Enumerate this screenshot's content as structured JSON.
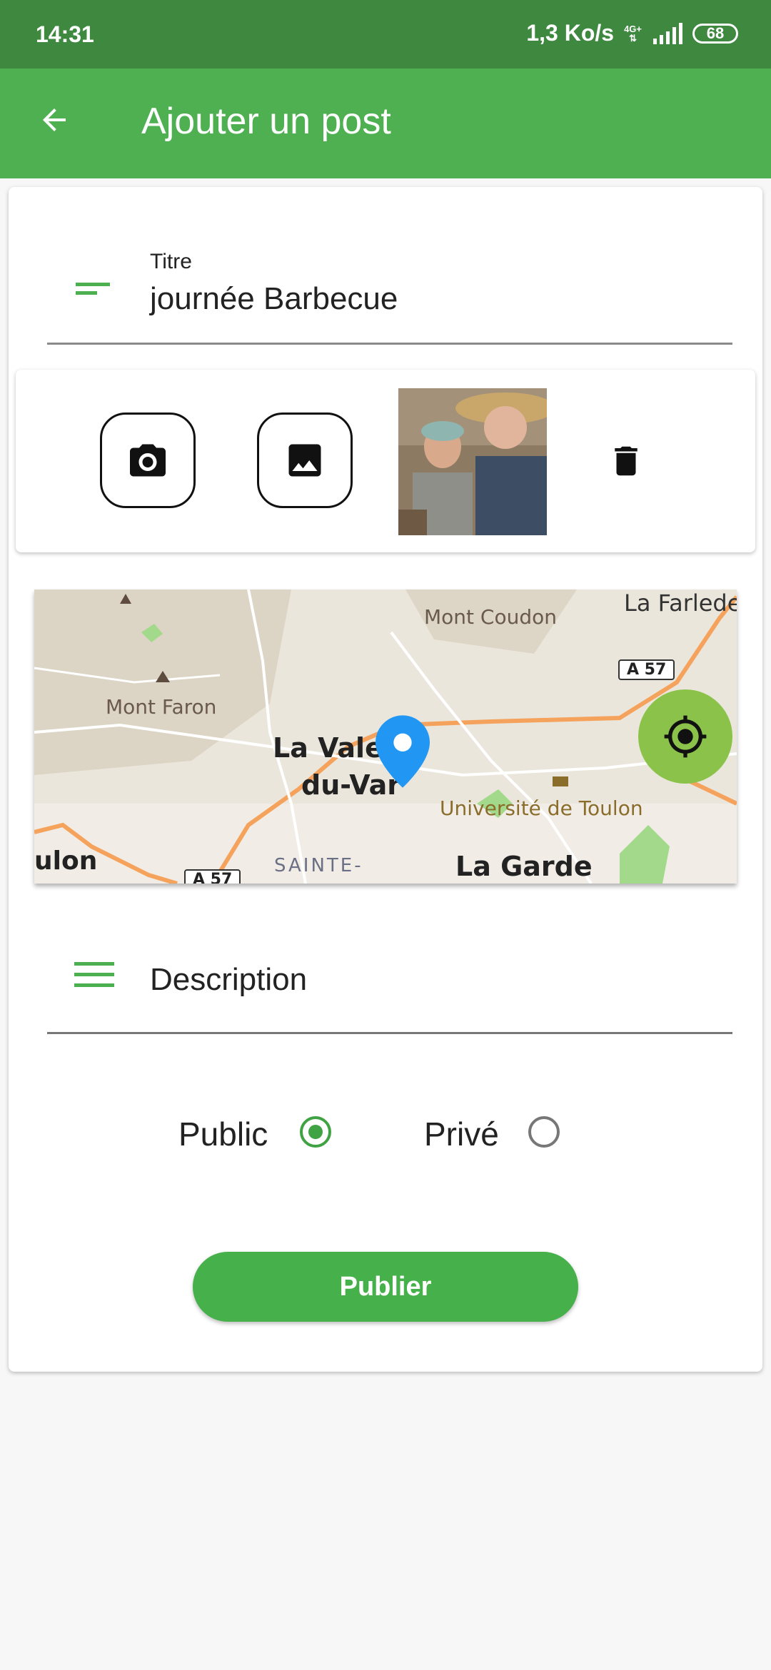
{
  "status_bar": {
    "time": "14:31",
    "net_speed": "1,3 Ko/s",
    "net_type": "4G+",
    "battery": "68"
  },
  "app_bar": {
    "title": "Ajouter un post"
  },
  "form": {
    "title_label": "Titre",
    "title_value": "journée Barbecue",
    "description_placeholder": "Description",
    "visibility": {
      "public_label": "Public",
      "private_label": "Privé",
      "selected": "Public"
    },
    "publish_label": "Publier"
  },
  "map": {
    "places": {
      "mont_coudon": "Mont Coudon",
      "la_farlede": "La Farlede",
      "mont_faron": "Mont Faron",
      "la_valette": "La Valette",
      "du_var": "du-Var",
      "universite": "Université de Toulon",
      "toulon": "ulon",
      "sainte": "SAINTE-",
      "la_garde": "La Garde",
      "a57_top": "A 57",
      "a57_bottom": "A 57"
    }
  },
  "colors": {
    "status_bar": "#3e8840",
    "app_bar": "#4fb052",
    "accent": "#46b04a",
    "fab": "#8bc34a",
    "marker": "#2196f3"
  }
}
